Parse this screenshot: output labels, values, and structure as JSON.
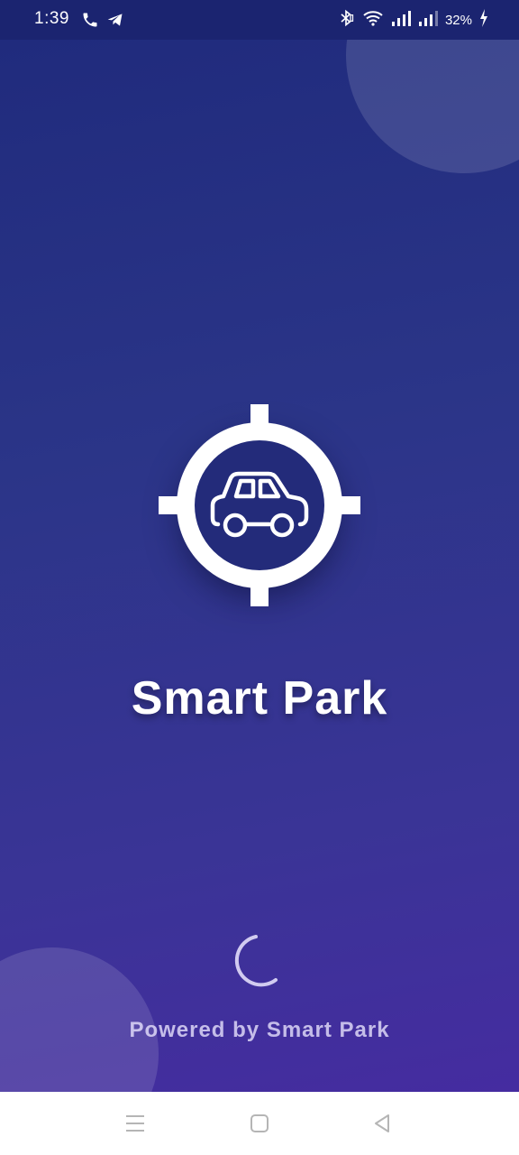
{
  "status_bar": {
    "time": "1:39",
    "battery_percent": "32%",
    "left_icons": [
      "phone-icon",
      "telegram-icon"
    ],
    "right_icons": [
      "bluetooth-icon",
      "wifi-icon",
      "signal-icon",
      "signal-icon"
    ]
  },
  "app": {
    "title": "Smart Park",
    "footer": "Powered by Smart Park",
    "logo_icon": "car-target-icon",
    "loading_icon": "spinner-icon"
  },
  "colors": {
    "background_top": "#1f2a7c",
    "background_bottom": "#452ca0",
    "logo_inner": "#232b7a",
    "white": "#ffffff"
  },
  "nav_bar": {
    "icons": [
      "menu-icon",
      "home-icon",
      "back-icon"
    ]
  }
}
